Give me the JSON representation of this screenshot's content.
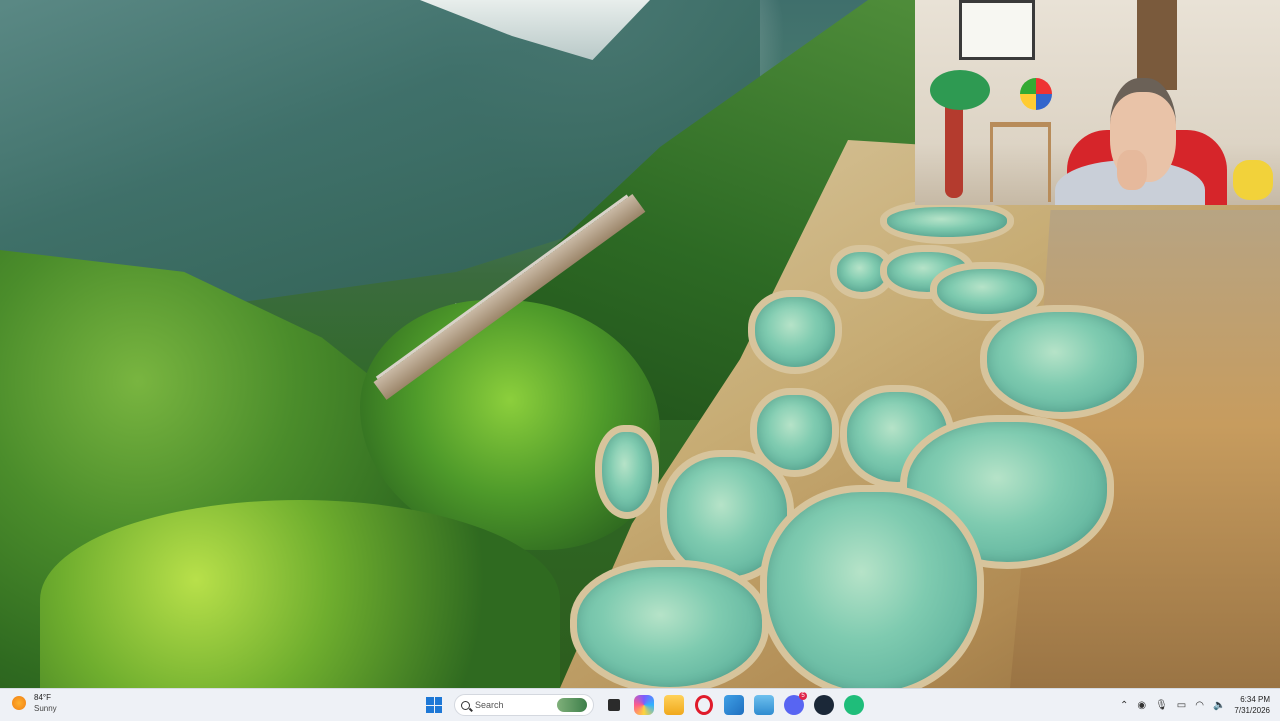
{
  "taskbar": {
    "weather": {
      "temperature": "84°F",
      "condition": "Sunny"
    },
    "search": {
      "placeholder": "Search"
    },
    "pinned_apps": [
      "start",
      "search",
      "task-view",
      "copilot",
      "file-explorer",
      "opera",
      "photos",
      "notepad",
      "discord",
      "steam",
      "app"
    ],
    "notifications": {
      "discord_badge": "5"
    },
    "clock": {
      "time": "6:34 PM",
      "date": "7/31/2026"
    }
  },
  "colors": {
    "taskbar_bg": "#eef1f6",
    "accent": "#1e78d6"
  }
}
